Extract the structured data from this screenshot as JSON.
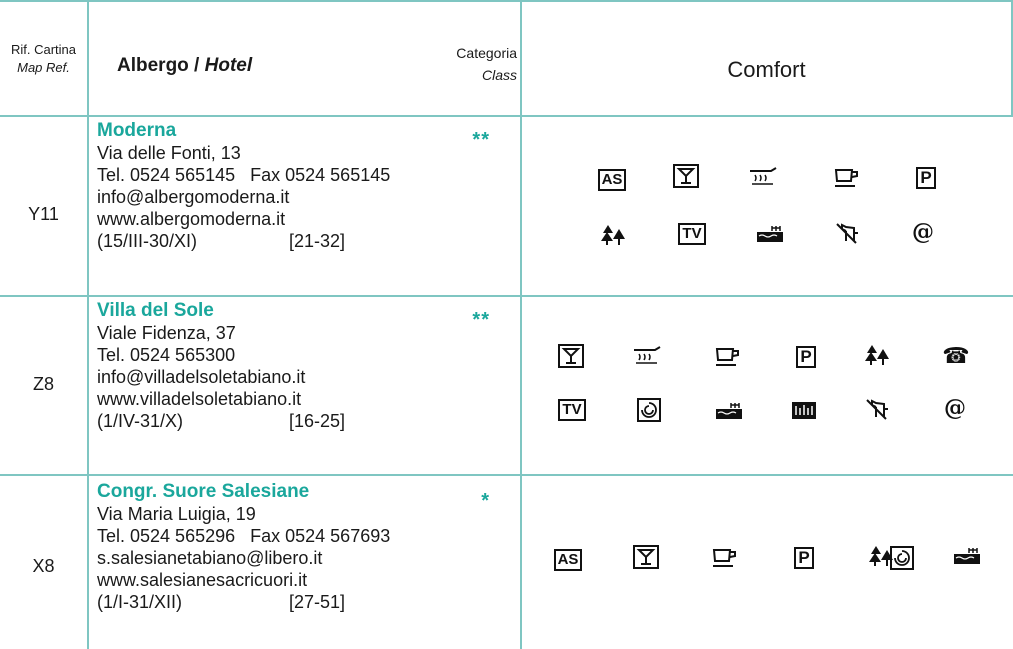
{
  "header": {
    "ref_label": "Rif. Cartina",
    "ref_label_en": "Map Ref.",
    "hotel_label": "Albergo / ",
    "hotel_label_en": "Hotel",
    "class_label": "Categoria",
    "class_label_en": "Class",
    "comfort_label": "Comfort"
  },
  "hotels": [
    {
      "ref": "Y11",
      "name": "Moderna",
      "stars": "**",
      "address": "Via delle Fonti, 13",
      "phone": "Tel. 0524 565145   Fax 0524 565145",
      "email": "info@albergomoderna.it",
      "web": "www.albergomoderna.it",
      "period": "(15/III-30/XI)",
      "beds": "[21-32]",
      "icons": [
        "AS",
        "bar-icon",
        "thermal-icon",
        "breakfast-icon",
        "P",
        "garden-icon",
        "TV",
        "pool-icon",
        "pets-icon",
        "@"
      ]
    },
    {
      "ref": "Z8",
      "name": "Villa del Sole",
      "stars": "**",
      "address": "Viale Fidenza, 37",
      "phone": "Tel. 0524 565300",
      "email": "info@villadelsoletabiano.it",
      "web": "www.villadelsoletabiano.it",
      "period": "(1/IV-31/X)",
      "beds": "[16-25]",
      "icons": [
        "bar-icon",
        "thermal-icon",
        "breakfast-icon",
        "P",
        "garden-icon",
        "phone-icon",
        "TV",
        "conditioning-icon",
        "pool-icon",
        "gym-icon",
        "pets-icon",
        "@"
      ]
    },
    {
      "ref": "X8",
      "name": "Congr. Suore Salesiane",
      "stars": "*",
      "address": "Via Maria Luigia, 19",
      "phone": "Tel. 0524 565296   Fax 0524 567693",
      "email": "s.salesianetabiano@libero.it",
      "web": "www.salesianesacricuori.it",
      "period": "(1/I-31/XII)",
      "beds": "[27-51]",
      "icons": [
        "AS",
        "bar-icon",
        "breakfast-icon",
        "P",
        "garden-icon",
        "conditioning-icon",
        "pool-icon"
      ]
    }
  ],
  "colors": {
    "accent": "#1aa79c",
    "rule": "#7fc6c2"
  }
}
